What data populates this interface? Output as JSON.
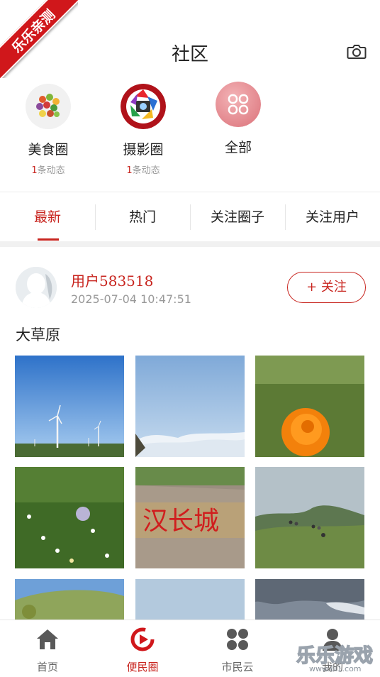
{
  "ribbon": {
    "text": "乐乐亲测"
  },
  "header": {
    "title": "社区",
    "camera_icon": "camera-icon"
  },
  "circles": [
    {
      "name": "美食圈",
      "count_num": "1",
      "count_suffix": "条动态",
      "icon": "food-circle-icon"
    },
    {
      "name": "摄影圈",
      "count_num": "1",
      "count_suffix": "条动态",
      "icon": "photography-circle-icon"
    },
    {
      "name": "全部",
      "icon": "all-circles-icon"
    }
  ],
  "tabs": [
    {
      "label": "最新",
      "active": true
    },
    {
      "label": "热门",
      "active": false
    },
    {
      "label": "关注圈子",
      "active": false
    },
    {
      "label": "关注用户",
      "active": false
    }
  ],
  "post": {
    "username": "用户583518",
    "timestamp": "2025-07-04 10:47:51",
    "follow_label": "+ 关注",
    "text": "大草原",
    "images": [
      "wind-turbines-blue-sky",
      "sea-of-clouds",
      "orange-globeflower",
      "grass-wildflowers",
      "rock-inscription",
      "hikers-on-grassland",
      "green-hill-cows",
      "cloudy-sky",
      "storm-clouds"
    ]
  },
  "bottom_nav": [
    {
      "label": "首页",
      "icon": "home-icon",
      "active": false
    },
    {
      "label": "便民圈",
      "icon": "community-play-icon",
      "active": true
    },
    {
      "label": "市民云",
      "icon": "clover-icon",
      "active": false
    },
    {
      "label": "我的",
      "icon": "user-icon",
      "active": false
    }
  ],
  "watermark": {
    "text": "乐乐游戏",
    "url": "www.6l1.com"
  },
  "colors": {
    "accent": "#c8251f",
    "ribbon": "#d0171b"
  }
}
